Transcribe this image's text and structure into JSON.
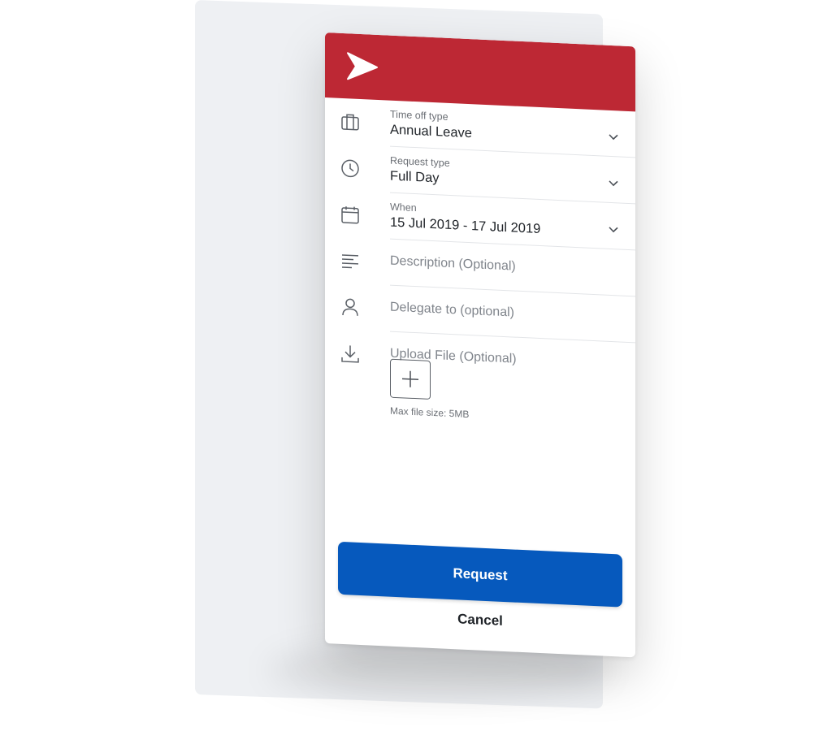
{
  "form": {
    "fields": [
      {
        "icon": "briefcase-icon",
        "label": "Time off type",
        "value": "Annual Leave"
      },
      {
        "icon": "clock-icon",
        "label": "Request type",
        "value": "Full Day"
      },
      {
        "icon": "calendar-icon",
        "label": "When",
        "value": "15 Jul 2019 - 17 Jul 2019"
      },
      {
        "icon": "text-lines-icon",
        "placeholder": "Description (Optional)"
      },
      {
        "icon": "person-icon",
        "placeholder": "Delegate to (optional)"
      },
      {
        "icon": "download-icon",
        "placeholder": "Upload File (Optional)"
      }
    ],
    "upload_hint": "Max file size: 5MB"
  },
  "actions": {
    "request_label": "Request",
    "cancel_label": "Cancel"
  },
  "colors": {
    "header": "#bd2834",
    "primary_button": "#0659bd",
    "backdrop": "#eef0f3"
  }
}
